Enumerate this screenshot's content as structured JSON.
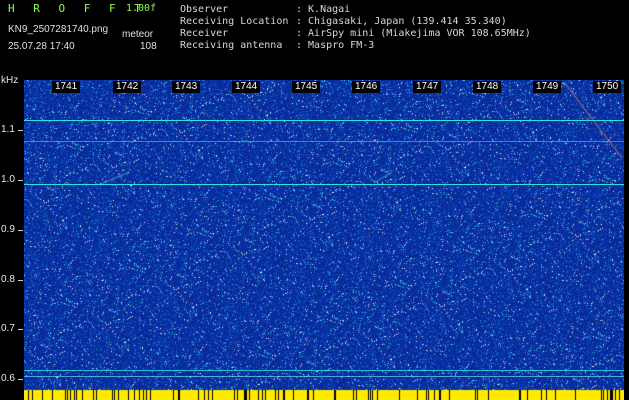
{
  "app": {
    "brand": "H R O F F T",
    "version": "1.00f",
    "filename": "KN9_2507281740.png",
    "mode": "meteor",
    "timestamp": "25.07.28 17:40",
    "count": "108"
  },
  "info": {
    "observer_label": "Observer",
    "observer_value": ": K.Nagai",
    "location_label": "Receiving Location",
    "location_value": ": Chigasaki, Japan (139.414 35.340)",
    "receiver_label": "Receiver",
    "receiver_value": ": AirSpy mini (Miakejima VOR 108.65MHz)",
    "antenna_label": "Receiving antenna",
    "antenna_value": ": Maspro FM-3"
  },
  "axis": {
    "y_unit": "kHz",
    "y_ticks": [
      "1.1",
      "1.0",
      "0.9",
      "0.8",
      "0.7",
      "0.6"
    ],
    "time_ticks": [
      "1741",
      "1742",
      "1743",
      "1744",
      "1745",
      "1746",
      "1747",
      "1748",
      "1749",
      "1750"
    ]
  },
  "colors": {
    "background": "#000000",
    "waterfall_base": "#0b2fae",
    "reference_line": "#33e0e0",
    "brand": "#8cff4c",
    "bottom_strip": "#ffea00"
  }
}
